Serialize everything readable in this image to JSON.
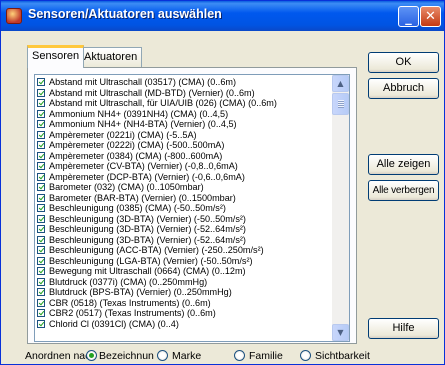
{
  "window": {
    "title": "Sensoren/Aktuatoren auswählen"
  },
  "tabs": [
    {
      "label": "Sensoren",
      "active": true
    },
    {
      "label": "Aktuatoren",
      "active": false
    }
  ],
  "sensor_list": [
    "Abstand mit Ultraschall (03517) (CMA) (0..6m)",
    "Abstand mit Ultraschall (MD-BTD) (Vernier) (0..6m)",
    "Abstand mit Ultraschall, für UIA/UIB (026) (CMA) (0..6m)",
    "Ammonium NH4+ (0391NH4) (CMA) (0..4,5)",
    "Ammonium NH4+ (NH4-BTA) (Vernier) (0..4,5)",
    "Ampèremeter (0221i) (CMA) (-5..5A)",
    "Ampèremeter (0222i) (CMA) (-500..500mA)",
    "Ampèremeter (0384) (CMA) (-800..600mA)",
    "Ampèremeter (CV-BTA) (Vernier) (-0,8..0,6mA)",
    "Ampèremeter (DCP-BTA) (Vernier) (-0,6..0,6mA)",
    "Barometer (032) (CMA) (0..1050mbar)",
    "Barometer (BAR-BTA) (Vernier) (0..1500mbar)",
    "Beschleunigung (0385) (CMA) (-50..50m/s²)",
    "Beschleunigung (3D-BTA) (Vernier) (-50..50m/s²)",
    "Beschleunigung (3D-BTA) (Vernier) (-52..64m/s²)",
    "Beschleunigung (3D-BTA) (Vernier) (-52..64m/s²)",
    "Beschleunigung (ACC-BTA) (Vernier) (-250..250m/s²)",
    "Beschleunigung (LGA-BTA) (Vernier) (-50..50m/s²)",
    "Bewegung mit Ultraschall (0664) (CMA) (0..12m)",
    "Blutdruck (0377i) (CMA) (0..250mmHg)",
    "Blutdruck (BPS-BTA) (Vernier) (0..250mmHg)",
    "CBR (0518) (Texas Instruments) (0..6m)",
    "CBR2 (0517) (Texas Instruments) (0..6m)",
    "Chlorid Cl (0391Cl) (CMA) (0..4)"
  ],
  "buttons": {
    "ok": "OK",
    "abbruch": "Abbruch",
    "alle_zeigen": "Alle zeigen",
    "alle_verbergen": "Alle verbergen",
    "hilfe": "Hilfe"
  },
  "sort": {
    "label": "Anordnen nac",
    "options": [
      {
        "label": "Bezeichnun",
        "checked": true
      },
      {
        "label": "Marke",
        "checked": false
      },
      {
        "label": "Familie",
        "checked": false
      },
      {
        "label": "Sichtbarkeit",
        "checked": false
      }
    ]
  },
  "icons": {
    "app": "app-icon",
    "minimize": "minimize-icon",
    "close": "close-icon",
    "scroll_up": "scroll-up-arrow-icon",
    "scroll_down": "scroll-down-arrow-icon"
  },
  "colors": {
    "titlebar": "#0054e3",
    "check": "#21a121",
    "tab_highlight": "#ffc83c"
  }
}
